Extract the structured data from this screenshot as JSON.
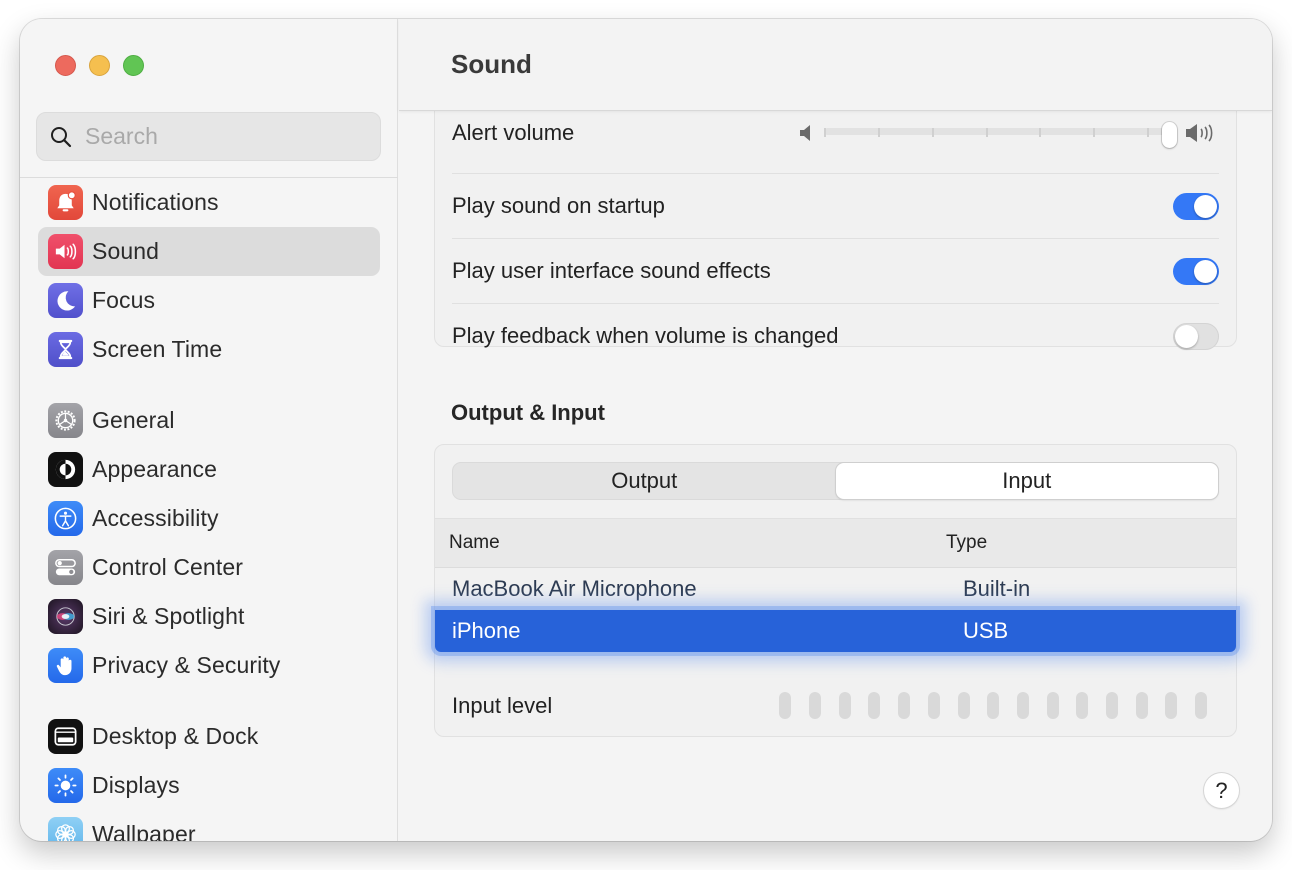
{
  "window": {
    "title": "Sound"
  },
  "sidebar": {
    "search": {
      "placeholder": "Search",
      "value": ""
    },
    "items": [
      {
        "label": "Notifications",
        "icon": "bell-icon",
        "color": "#e8503f",
        "selected": false
      },
      {
        "label": "Sound",
        "icon": "speaker-icon",
        "color": "#e9405f",
        "selected": true
      },
      {
        "label": "Focus",
        "icon": "moon-icon",
        "color": "#5b5bd6",
        "selected": false
      },
      {
        "label": "Screen Time",
        "icon": "hourglass-icon",
        "color": "#5b5bd6",
        "selected": false
      },
      {
        "label": "General",
        "icon": "gear-icon",
        "color": "#8e8e93",
        "selected": false
      },
      {
        "label": "Appearance",
        "icon": "appearance-icon",
        "color": "#111111",
        "selected": false
      },
      {
        "label": "Accessibility",
        "icon": "accessibility-icon",
        "color": "#2f7cf6",
        "selected": false
      },
      {
        "label": "Control Center",
        "icon": "switches-icon",
        "color": "#8e8e93",
        "selected": false
      },
      {
        "label": "Siri & Spotlight",
        "icon": "siri-icon",
        "color": "#3a2740",
        "selected": false
      },
      {
        "label": "Privacy & Security",
        "icon": "hand-icon",
        "color": "#2f7cf6",
        "selected": false
      },
      {
        "label": "Desktop & Dock",
        "icon": "dock-icon",
        "color": "#111111",
        "selected": false
      },
      {
        "label": "Displays",
        "icon": "sun-icon",
        "color": "#2f7cf6",
        "selected": false
      },
      {
        "label": "Wallpaper",
        "icon": "flower-icon",
        "color": "#6fbff0",
        "selected": false
      }
    ]
  },
  "main": {
    "title": "Sound",
    "sound_effects": {
      "alert_volume_label": "Alert volume",
      "alert_volume_value": 1.0,
      "toggles": [
        {
          "label": "Play sound on startup",
          "on": true
        },
        {
          "label": "Play user interface sound effects",
          "on": true
        },
        {
          "label": "Play feedback when volume is changed",
          "on": false
        }
      ]
    },
    "output_input": {
      "section_title": "Output & Input",
      "tabs": [
        {
          "label": "Output",
          "active": false
        },
        {
          "label": "Input",
          "active": true
        }
      ],
      "table": {
        "columns": [
          "Name",
          "Type"
        ],
        "rows": [
          {
            "name": "MacBook Air Microphone",
            "type": "Built-in",
            "selected": false
          },
          {
            "name": "iPhone",
            "type": "USB",
            "selected": true
          }
        ]
      },
      "input_level": {
        "label": "Input level",
        "bars_total": 15,
        "bars_lit": 0
      }
    },
    "help_label": "?"
  },
  "colors": {
    "accent": "#3478f6",
    "selection": "#2762d9"
  }
}
